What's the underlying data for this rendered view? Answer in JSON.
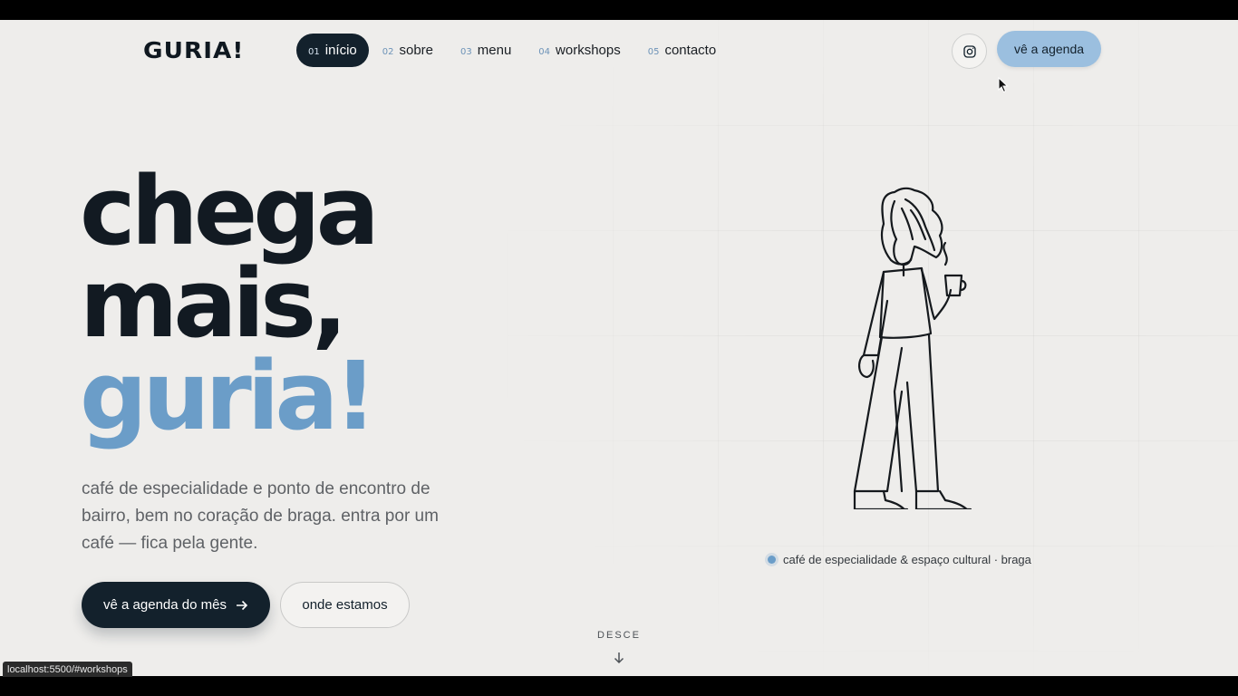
{
  "header": {
    "logo": "GURIA!",
    "nav": [
      {
        "num": "01",
        "label": "início",
        "active": true
      },
      {
        "num": "02",
        "label": "sobre",
        "active": false
      },
      {
        "num": "03",
        "label": "menu",
        "active": false
      },
      {
        "num": "04",
        "label": "workshops",
        "active": false
      },
      {
        "num": "05",
        "label": "contacto",
        "active": false
      }
    ],
    "instagram_icon": "instagram-icon",
    "agenda_button": "vê a agenda"
  },
  "hero": {
    "headline_line1": "chega",
    "headline_line2": "mais,",
    "headline_line3": "guria!",
    "lead": "café de especialidade e ponto de encontro de bairro, bem no coração de braga. entra por um café — fica pela gente.",
    "cta_primary": "vê a agenda do mês",
    "cta_primary_icon": "arrow-right-icon",
    "cta_secondary": "onde estamos",
    "caption": "café de especialidade & espaço cultural · braga",
    "scroll_label": "DESCE",
    "scroll_icon": "arrow-down-icon"
  },
  "status_bar": {
    "url": "localhost:5500/#workshops"
  },
  "colors": {
    "background": "#eeedeb",
    "dark": "#13212c",
    "accent": "#6b9dc8",
    "button_light": "#9bbfdf"
  }
}
